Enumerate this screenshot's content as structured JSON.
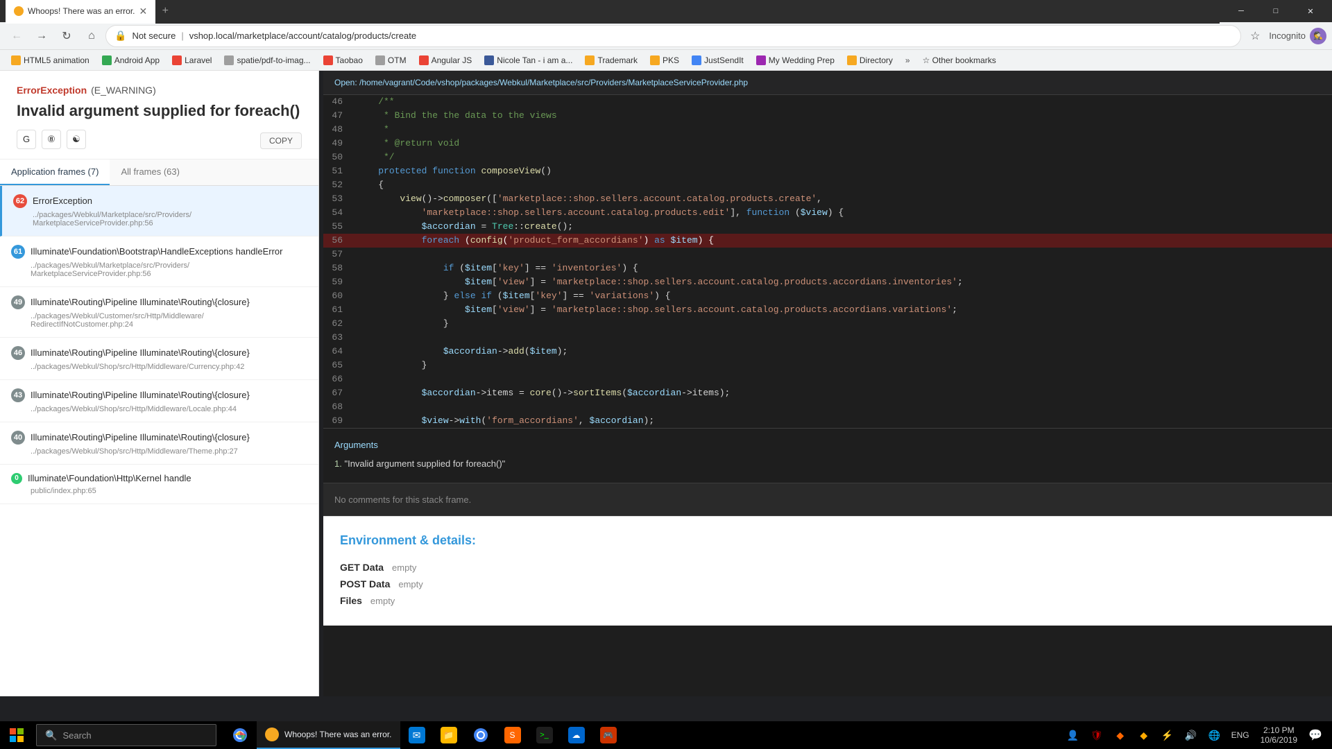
{
  "browser": {
    "tab": {
      "title": "Whoops! There was an error.",
      "favicon": "orange"
    },
    "nav": {
      "address": "vshop.local/marketplace/account/catalog/products/create",
      "protocol": "Not secure",
      "incognito": "Incognito"
    },
    "bookmarks": [
      {
        "label": "HTML5 animation",
        "color": "orange"
      },
      {
        "label": "Android App",
        "color": "green"
      },
      {
        "label": "Laravel",
        "color": "red"
      },
      {
        "label": "spatie/pdf-to-imag...",
        "color": "gray"
      },
      {
        "label": "Taobao",
        "color": "red"
      },
      {
        "label": "OTM",
        "color": "gray"
      },
      {
        "label": "Angular JS",
        "color": "red"
      },
      {
        "label": "Nicole Tan - i am a...",
        "color": "fb"
      },
      {
        "label": "Trademark",
        "color": "orange"
      },
      {
        "label": "PKS",
        "color": "orange"
      },
      {
        "label": "JustSendIt",
        "color": "blue"
      },
      {
        "label": "My Wedding Prep",
        "color": "purple"
      },
      {
        "label": "Directory",
        "color": "orange"
      }
    ]
  },
  "error": {
    "exception_name": "ErrorException",
    "exception_type": "(E_WARNING)",
    "message": "Invalid argument supplied for foreach()",
    "copy_label": "COPY"
  },
  "frame_tabs": {
    "app_frames_label": "Application frames (7)",
    "all_frames_label": "All frames (63)"
  },
  "frames": [
    {
      "number": 62,
      "class": "ErrorException",
      "path": "../packages/Webkul/Marketplace/src/Providers/\nMarketplaceServiceProvider.php:56",
      "is_error": true
    },
    {
      "number": 61,
      "class": "Illuminate\\Foundation\\Bootstrap\\HandleExceptions handleError",
      "path": "../packages/Webkul/Marketplace/src/Providers/\nMarketplaceServiceProvider.php:56",
      "is_error": false
    },
    {
      "number": 49,
      "class": "Illuminate\\Routing\\Pipeline Illuminate\\Routing\\{closure}",
      "path": "../packages/Webkul/Customer/src/Http/Middleware/\nRedirectIfNotCustomer.php:24",
      "is_error": false
    },
    {
      "number": 46,
      "class": "Illuminate\\Routing\\Pipeline Illuminate\\Routing\\{closure}",
      "path": "../packages/Webkul/Shop/src/Http/Middleware/Currency.php:42",
      "is_error": false
    },
    {
      "number": 43,
      "class": "Illuminate\\Routing\\Pipeline Illuminate\\Routing\\{closure}",
      "path": "../packages/Webkul/Shop/src/Http/Middleware/Locale.php:44",
      "is_error": false
    },
    {
      "number": 40,
      "class": "Illuminate\\Routing\\Pipeline Illuminate\\Routing\\{closure}",
      "path": "../packages/Webkul/Shop/src/Http/Middleware/Theme.php:27",
      "is_error": false
    },
    {
      "number": 0,
      "class": "Illuminate\\Foundation\\Http\\Kernel handle",
      "path": "public/index.php:65",
      "is_error": false
    }
  ],
  "code": {
    "file_path": "Open: /home/vagrant/Code/vshop/packages/Webkul/Marketplace/src/Providers/MarketplaceServiceProvider.php",
    "lines": [
      {
        "num": 46,
        "content": "    /**"
      },
      {
        "num": 47,
        "content": "     * Bind the the data to the views"
      },
      {
        "num": 48,
        "content": "     *"
      },
      {
        "num": 49,
        "content": "     * @return void"
      },
      {
        "num": 50,
        "content": "     */"
      },
      {
        "num": 51,
        "content": "    protected function composeView()"
      },
      {
        "num": 52,
        "content": "    {"
      },
      {
        "num": 53,
        "content": "        view()->composer(['marketplace::shop.sellers.account.catalog.products.create',"
      },
      {
        "num": 54,
        "content": "            'marketplace::shop.sellers.account.catalog.products.edit'], function ($view) {"
      },
      {
        "num": 55,
        "content": "            $accordian = Tree::create();"
      },
      {
        "num": 56,
        "content": "            foreach (config('product_form_accordians') as $item) {",
        "highlighted": true
      },
      {
        "num": 57,
        "content": ""
      },
      {
        "num": 58,
        "content": "                if ($item['key'] == 'inventories') {"
      },
      {
        "num": 59,
        "content": "                    $item['view'] = 'marketplace::shop.sellers.account.catalog.products.accordians.inventories';"
      },
      {
        "num": 60,
        "content": "                } else if ($item['key'] == 'variations') {"
      },
      {
        "num": 61,
        "content": "                    $item['view'] = 'marketplace::shop.sellers.account.catalog.products.accordians.variations';"
      },
      {
        "num": 62,
        "content": "                }"
      },
      {
        "num": 63,
        "content": ""
      },
      {
        "num": 64,
        "content": "                $accordian->add($item);"
      },
      {
        "num": 65,
        "content": "            }"
      },
      {
        "num": 66,
        "content": ""
      },
      {
        "num": 67,
        "content": "            $accordian->items = core()->sortItems($accordian->items);"
      },
      {
        "num": 68,
        "content": ""
      },
      {
        "num": 69,
        "content": "            $view->with('form_accordians', $accordian);"
      }
    ],
    "arguments_title": "Arguments",
    "argument_1": "\"Invalid argument supplied for foreach()\"",
    "no_comments": "No comments for this stack frame."
  },
  "environment": {
    "title": "Environment & details:",
    "get_data_label": "GET Data",
    "get_data_value": "empty",
    "post_data_label": "POST Data",
    "post_data_value": "empty",
    "files_label": "Files",
    "files_value": "empty"
  },
  "taskbar": {
    "search_placeholder": "Search",
    "clock": "2:10 PM",
    "date": "10/6/2019",
    "language": "ENG"
  }
}
